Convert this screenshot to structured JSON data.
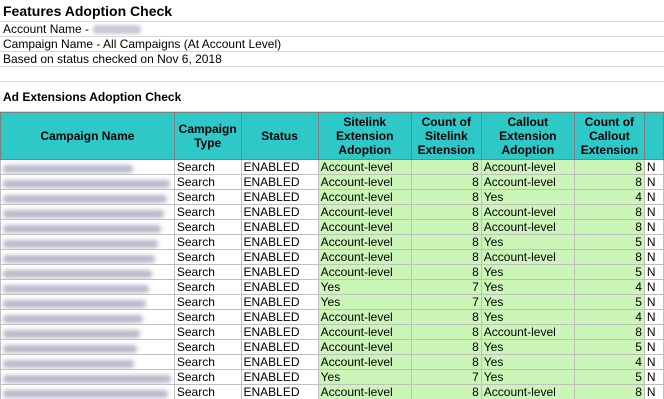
{
  "report": {
    "title": "Features Adoption Check",
    "account_label": "Account Name -",
    "campaign_line": "Campaign Name - All Campaigns (At Account Level)",
    "status_line": "Based on status checked on Nov 6, 2018",
    "section_title": "Ad Extensions Adoption Check"
  },
  "table": {
    "headers": [
      "Campaign Name",
      "Campaign Type",
      "Status",
      "Sitelink Extension Adoption",
      "Count of Sitelink Extension",
      "Callout Extension Adoption",
      "Count of Callout Extension"
    ],
    "rows": [
      [
        "Search",
        "ENABLED",
        "Account-level",
        "8",
        "Account-level",
        "8"
      ],
      [
        "Search",
        "ENABLED",
        "Account-level",
        "8",
        "Account-level",
        "8"
      ],
      [
        "Search",
        "ENABLED",
        "Account-level",
        "8",
        "Yes",
        "4"
      ],
      [
        "Search",
        "ENABLED",
        "Account-level",
        "8",
        "Account-level",
        "8"
      ],
      [
        "Search",
        "ENABLED",
        "Account-level",
        "8",
        "Account-level",
        "8"
      ],
      [
        "Search",
        "ENABLED",
        "Account-level",
        "8",
        "Yes",
        "5"
      ],
      [
        "Search",
        "ENABLED",
        "Account-level",
        "8",
        "Account-level",
        "8"
      ],
      [
        "Search",
        "ENABLED",
        "Account-level",
        "8",
        "Yes",
        "5"
      ],
      [
        "Search",
        "ENABLED",
        "Yes",
        "7",
        "Yes",
        "4"
      ],
      [
        "Search",
        "ENABLED",
        "Yes",
        "7",
        "Yes",
        "5"
      ],
      [
        "Search",
        "ENABLED",
        "Account-level",
        "8",
        "Yes",
        "4"
      ],
      [
        "Search",
        "ENABLED",
        "Account-level",
        "8",
        "Account-level",
        "8"
      ],
      [
        "Search",
        "ENABLED",
        "Account-level",
        "8",
        "Yes",
        "5"
      ],
      [
        "Search",
        "ENABLED",
        "Account-level",
        "8",
        "Yes",
        "4"
      ],
      [
        "Search",
        "ENABLED",
        "Yes",
        "7",
        "Yes",
        "5"
      ],
      [
        "Search",
        "ENABLED",
        "Account-level",
        "8",
        "Account-level",
        "8"
      ]
    ],
    "overflow_col": [
      "N",
      "N",
      "N",
      "N",
      "N",
      "N",
      "N",
      "N",
      "N",
      "N",
      "N",
      "N",
      "N",
      "N",
      "N",
      "N"
    ]
  },
  "colors": {
    "header_bg": "#2ec8c8",
    "adoption_bg": "#ccf5b8"
  }
}
